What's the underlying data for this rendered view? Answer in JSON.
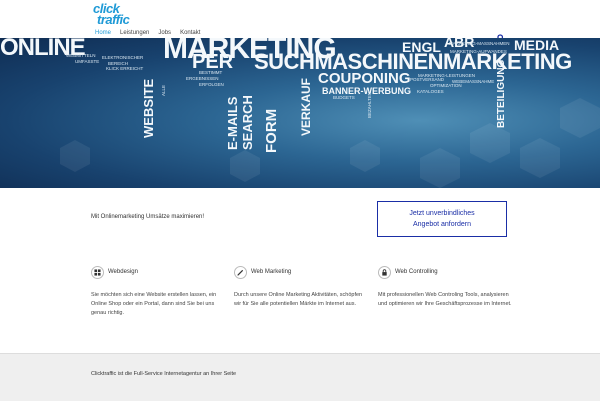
{
  "header": {
    "logo_line1": "click",
    "logo_line2": "traffic",
    "nav": [
      {
        "label": "Home"
      },
      {
        "label": "Leistungen"
      },
      {
        "label": "Jobs"
      },
      {
        "label": "Kontakt"
      }
    ],
    "search_icon": "search-icon"
  },
  "hero": {
    "words": {
      "online": "ONLINE",
      "marketing": "MARKETING",
      "engl": "ENGL",
      "abr": "ABR",
      "media": "MEDIA",
      "per": "PER",
      "emails": "E-MAILS",
      "search": "SEARCH",
      "form": "FORM",
      "suchmaschinenmarketing": "SUCHMASCHINENMARKETING",
      "couponing": "COUPONING",
      "banner": "BANNER-WERBUNG",
      "budgets": "BUDGETS",
      "website": "WEBSITE",
      "verkauf": "VERKAUF",
      "beteiligung": "BETEILIGUNG",
      "mm": "MARKETING-MASSNAHMEN",
      "ma": "MARKETING-AUFWANDES",
      "ml": "MARKETING-LEISTUNGEN",
      "wm": "WEBEMASSNAHME",
      "opt": "OPTIMIZATION",
      "kat": "KATALOGES",
      "pv": "POSTVERSAND",
      "wp": "WEBMITTELN",
      "ek": "ELEKTRONISCHER",
      "um": "UMFASSTE",
      "ber": "BEREICH",
      "erf": "ERFOLGEN",
      "bes": "BESTIMMT",
      "erg": "ERGEBNISSEN",
      "kl": "KLICK ERREICHT",
      "all": "ALLE",
      "bez": "BEZAHLTEN"
    }
  },
  "content": {
    "tagline": "Mit Onlinemarketing Umsätze maximieren!",
    "cta_line1": "Jetzt unverbindliches",
    "cta_line2": "Angebot anfordern"
  },
  "features": [
    {
      "icon": "grid-icon",
      "title": "Webdesign",
      "text": "Sie möchten sich eine Website erstellen lassen, ein Online Shop oder ein Portal, dann sind Sie bei uns genau richtig."
    },
    {
      "icon": "pen-icon",
      "title": "Web Marketing",
      "text": "Durch unsere Online Marketing Aktivitäten, schöpfen wir für Sie alle potentiellen Märkte im Internet aus."
    },
    {
      "icon": "lock-icon",
      "title": "Web Controlling",
      "text": "Mit professionellen Web Controling Tools, analysieren und optimieren wir Ihre Geschäftsprozesse im Internet."
    }
  ],
  "footer": {
    "text": "Clicktraffic ist die Full-Service Internetagentur an Ihrer Seite"
  }
}
